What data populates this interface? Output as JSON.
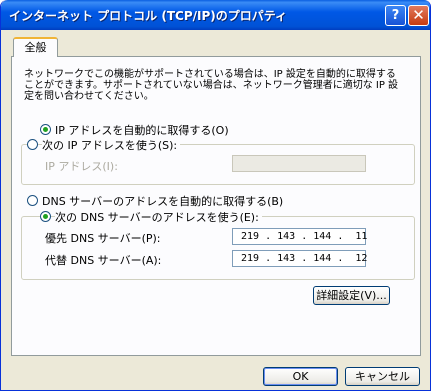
{
  "window": {
    "title": "インターネット プロトコル (TCP/IP)のプロパティ",
    "help_glyph": "?",
    "close_glyph": "✕"
  },
  "tabs": [
    {
      "label": "全般",
      "active": true
    }
  ],
  "description": [
    "ネットワークでこの機能がサポートされている場合は、IP 設定を自動的に取得する",
    "ことができます。サポートされていない場合は、ネットワーク管理者に適切な IP 設",
    "定を問い合わせてください。"
  ],
  "ip": {
    "auto_label": "IP アドレスを自動的に取得する(O)",
    "manual_label": "次の IP アドレスを使う(S):",
    "address_label": "IP アドレス(I):",
    "address_value": "",
    "selected": "auto"
  },
  "dns": {
    "auto_label": "DNS サーバーのアドレスを自動的に取得する(B)",
    "manual_label": "次の DNS サーバーのアドレスを使う(E):",
    "preferred_label": "優先 DNS サーバー(P):",
    "preferred_value": "219 . 143 . 144 .  11",
    "alternate_label": "代替 DNS サーバー(A):",
    "alternate_value": "219 . 143 . 144 .  12",
    "selected": "manual"
  },
  "buttons": {
    "advanced": "詳細設定(V)...",
    "ok": "OK",
    "cancel": "キャンセル"
  },
  "colors": {
    "titlebar": "#0058e6",
    "dialog_bg": "#ece9d8",
    "panel_bg": "#fcfcfe",
    "radio_dot": "#21a121",
    "close_button": "#c53b10"
  }
}
